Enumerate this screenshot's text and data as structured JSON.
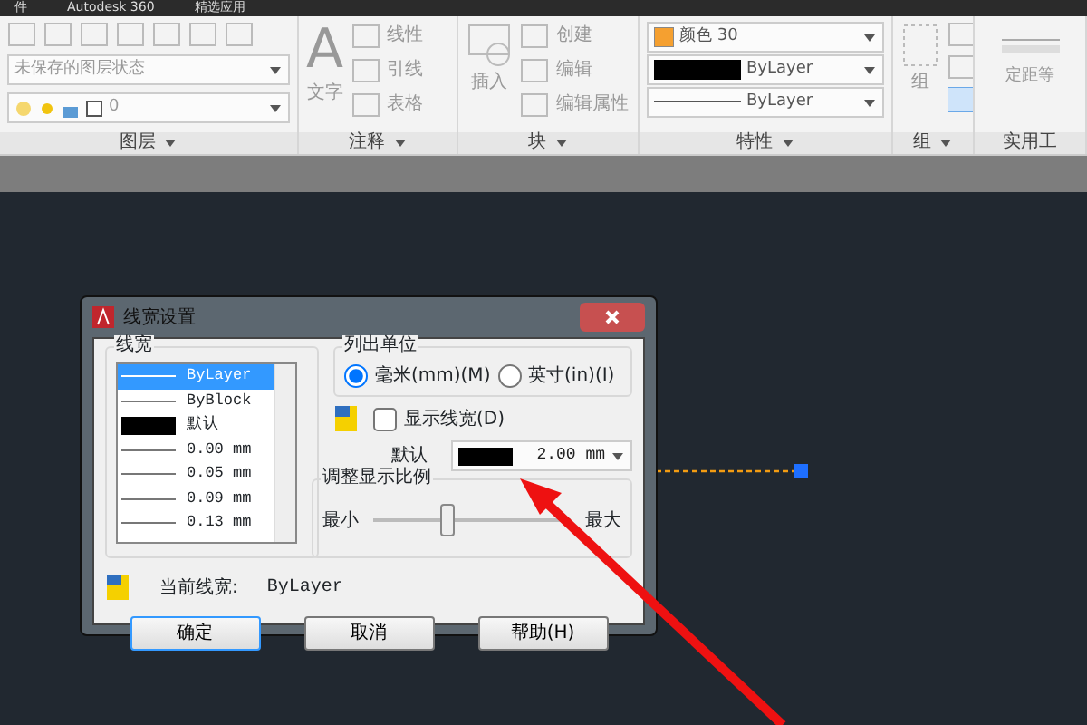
{
  "menu_bar": [
    "件",
    "Autodesk 360",
    "精选应用"
  ],
  "ribbon": {
    "panels": [
      {
        "kind": "layers",
        "title": "图层",
        "layer_state": "未保存的图层状态",
        "layer": "0"
      },
      {
        "kind": "annotation",
        "title": "注释",
        "text_icon": "A",
        "text_tool": "文字",
        "tools": [
          "线性",
          "引线",
          "表格"
        ]
      },
      {
        "kind": "block",
        "title": "块",
        "insert": "插入",
        "tools": [
          "创建",
          "编辑",
          "编辑属性"
        ]
      },
      {
        "kind": "properties",
        "title": "特性",
        "color_name": "颜色 30",
        "lineweight": "ByLayer",
        "linetype": "ByLayer"
      },
      {
        "kind": "group",
        "title": "组",
        "group": "组"
      },
      {
        "kind": "utilities",
        "title": "实用工",
        "measure": "定距等"
      }
    ]
  },
  "dialog": {
    "title": "线宽设置",
    "lineweights": {
      "label": "线宽",
      "items": [
        {
          "kind": "line",
          "label": "ByLayer",
          "selected": true
        },
        {
          "kind": "line",
          "label": "ByBlock",
          "selected": false
        },
        {
          "kind": "swatch",
          "label": "默认",
          "selected": false
        },
        {
          "kind": "line",
          "label": "0.00 mm",
          "selected": false
        },
        {
          "kind": "line",
          "label": "0.05 mm",
          "selected": false
        },
        {
          "kind": "line",
          "label": "0.09 mm",
          "selected": false
        },
        {
          "kind": "line",
          "label": "0.13 mm",
          "selected": false
        }
      ]
    },
    "units": {
      "label": "列出单位",
      "options": [
        {
          "label": "毫米(mm)(M)",
          "selected": true
        },
        {
          "label": "英寸(in)(I)",
          "selected": false
        }
      ]
    },
    "display_lineweight": {
      "label": "显示线宽(D)",
      "checked": false
    },
    "default": {
      "label": "默认",
      "value": "2.00 mm"
    },
    "scale": {
      "label": "调整显示比例",
      "min_label": "最小",
      "max_label": "最大",
      "level": 0.38
    },
    "current": {
      "label": "当前线宽:",
      "value": "ByLayer"
    },
    "buttons": [
      "确定",
      "取消",
      "帮助(H)"
    ]
  }
}
